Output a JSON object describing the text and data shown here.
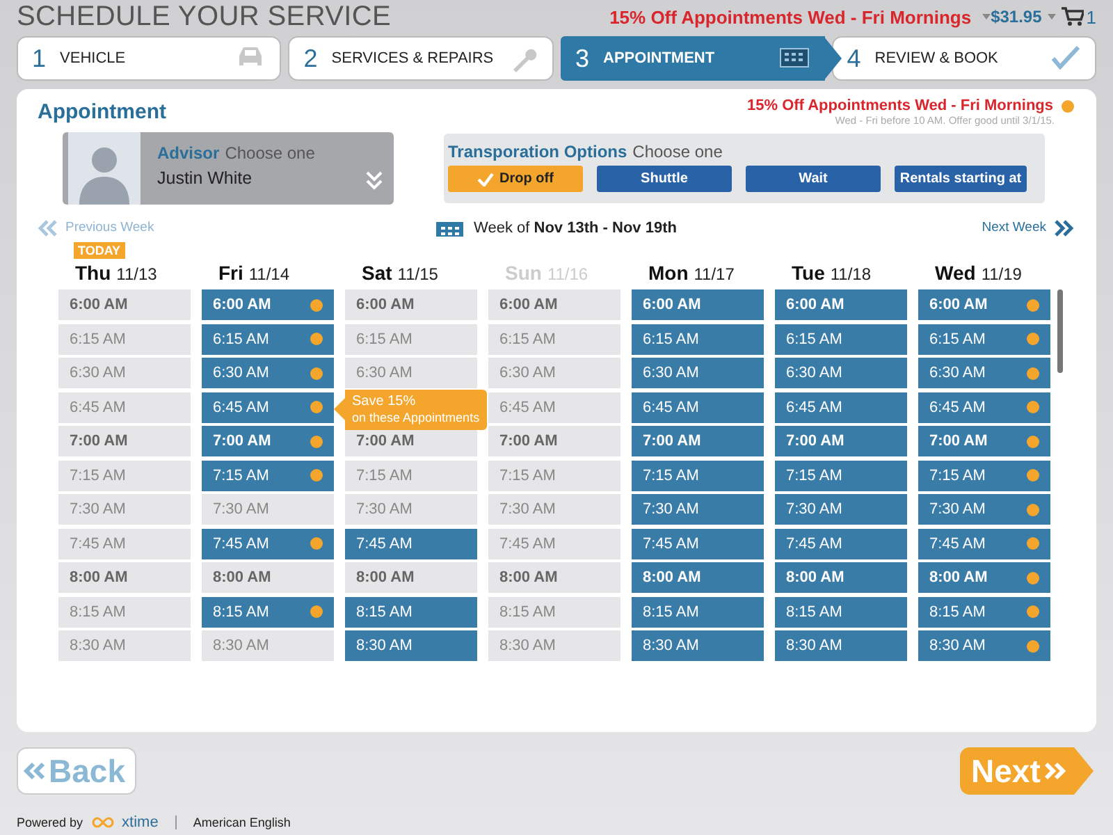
{
  "header": {
    "title": "SCHEDULE YOUR SERVICE",
    "promo": "15% Off Appointments Wed - Fri Mornings",
    "price": "$31.95",
    "cart_count": "1"
  },
  "steps": [
    {
      "number": "1",
      "label": "VEHICLE",
      "selected": false
    },
    {
      "number": "2",
      "label": "SERVICES & REPAIRS",
      "selected": false
    },
    {
      "number": "3",
      "label": "APPOINTMENT",
      "selected": true
    },
    {
      "number": "4",
      "label": "REVIEW & BOOK",
      "selected": false
    }
  ],
  "panel": {
    "title": "Appointment",
    "offer_title": "15% Off Appointments Wed - Fri Mornings",
    "offer_note": "Wed - Fri before 10 AM. Offer good until 3/1/15."
  },
  "advisor": {
    "label": "Advisor",
    "hint": "Choose one",
    "value": "Justin White"
  },
  "transportation": {
    "label": "Transporation Options",
    "hint": "Choose one",
    "options": [
      {
        "label": "Drop off",
        "selected": true
      },
      {
        "label": "Shuttle",
        "selected": false
      },
      {
        "label": "Wait",
        "selected": false
      },
      {
        "label": "Rentals starting at",
        "selected": false
      }
    ]
  },
  "week_nav": {
    "previous": "Previous Week",
    "week_prefix": "Week of",
    "week_range": "Nov 13th - Nov 19th",
    "next": "Next Week"
  },
  "days": [
    {
      "name": "Thu",
      "date": "11/13",
      "badge": "TODAY",
      "disabled": false,
      "slots": [
        {
          "time": "6:00 AM",
          "bold": true,
          "available": false,
          "discount": false
        },
        {
          "time": "6:15 AM",
          "bold": false,
          "available": false,
          "discount": false
        },
        {
          "time": "6:30 AM",
          "bold": false,
          "available": false,
          "discount": false
        },
        {
          "time": "6:45 AM",
          "bold": false,
          "available": false,
          "discount": false
        },
        {
          "time": "7:00 AM",
          "bold": true,
          "available": false,
          "discount": false
        },
        {
          "time": "7:15 AM",
          "bold": false,
          "available": false,
          "discount": false
        },
        {
          "time": "7:30 AM",
          "bold": false,
          "available": false,
          "discount": false
        },
        {
          "time": "7:45 AM",
          "bold": false,
          "available": false,
          "discount": false
        },
        {
          "time": "8:00 AM",
          "bold": true,
          "available": false,
          "discount": false
        },
        {
          "time": "8:15 AM",
          "bold": false,
          "available": false,
          "discount": false
        },
        {
          "time": "8:30 AM",
          "bold": false,
          "available": false,
          "discount": false
        }
      ]
    },
    {
      "name": "Fri",
      "date": "11/14",
      "disabled": false,
      "slots": [
        {
          "time": "6:00 AM",
          "bold": true,
          "available": true,
          "discount": true
        },
        {
          "time": "6:15 AM",
          "bold": false,
          "available": true,
          "discount": true
        },
        {
          "time": "6:30 AM",
          "bold": false,
          "available": true,
          "discount": true
        },
        {
          "time": "6:45 AM",
          "bold": false,
          "available": true,
          "discount": true
        },
        {
          "time": "7:00 AM",
          "bold": true,
          "available": true,
          "discount": true
        },
        {
          "time": "7:15 AM",
          "bold": false,
          "available": true,
          "discount": true
        },
        {
          "time": "7:30 AM",
          "bold": false,
          "available": false,
          "discount": false
        },
        {
          "time": "7:45 AM",
          "bold": false,
          "available": true,
          "discount": true
        },
        {
          "time": "8:00 AM",
          "bold": true,
          "available": false,
          "discount": false
        },
        {
          "time": "8:15 AM",
          "bold": false,
          "available": true,
          "discount": true
        },
        {
          "time": "8:30 AM",
          "bold": false,
          "available": false,
          "discount": false
        }
      ]
    },
    {
      "name": "Sat",
      "date": "11/15",
      "disabled": false,
      "slots": [
        {
          "time": "6:00 AM",
          "bold": true,
          "available": false,
          "discount": false
        },
        {
          "time": "6:15 AM",
          "bold": false,
          "available": false,
          "discount": false
        },
        {
          "time": "6:30 AM",
          "bold": false,
          "available": false,
          "discount": false
        },
        {
          "tooltip": {
            "line1": "Save 15%",
            "line2": "on these Appointments"
          }
        },
        {
          "time": "7:00 AM",
          "bold": true,
          "available": false,
          "discount": false
        },
        {
          "time": "7:15 AM",
          "bold": false,
          "available": false,
          "discount": false
        },
        {
          "time": "7:30 AM",
          "bold": false,
          "available": false,
          "discount": false
        },
        {
          "time": "7:45 AM",
          "bold": false,
          "available": true,
          "discount": false
        },
        {
          "time": "8:00 AM",
          "bold": true,
          "available": false,
          "discount": false
        },
        {
          "time": "8:15 AM",
          "bold": false,
          "available": true,
          "discount": false
        },
        {
          "time": "8:30 AM",
          "bold": false,
          "available": true,
          "discount": false
        }
      ]
    },
    {
      "name": "Sun",
      "date": "11/16",
      "disabled": true,
      "slots": [
        {
          "time": "6:00 AM",
          "bold": true,
          "available": false,
          "discount": false
        },
        {
          "time": "6:15 AM",
          "bold": false,
          "available": false,
          "discount": false
        },
        {
          "time": "6:30 AM",
          "bold": false,
          "available": false,
          "discount": false
        },
        {
          "time": "6:45 AM",
          "bold": false,
          "available": false,
          "discount": false
        },
        {
          "time": "7:00 AM",
          "bold": true,
          "available": false,
          "discount": false
        },
        {
          "time": "7:15 AM",
          "bold": false,
          "available": false,
          "discount": false
        },
        {
          "time": "7:30 AM",
          "bold": false,
          "available": false,
          "discount": false
        },
        {
          "time": "7:45 AM",
          "bold": false,
          "available": false,
          "discount": false
        },
        {
          "time": "8:00 AM",
          "bold": true,
          "available": false,
          "discount": false
        },
        {
          "time": "8:15 AM",
          "bold": false,
          "available": false,
          "discount": false
        },
        {
          "time": "8:30 AM",
          "bold": false,
          "available": false,
          "discount": false
        }
      ]
    },
    {
      "name": "Mon",
      "date": "11/17",
      "disabled": false,
      "slots": [
        {
          "time": "6:00 AM",
          "bold": true,
          "available": true,
          "discount": false
        },
        {
          "time": "6:15 AM",
          "bold": false,
          "available": true,
          "discount": false
        },
        {
          "time": "6:30 AM",
          "bold": false,
          "available": true,
          "discount": false
        },
        {
          "time": "6:45 AM",
          "bold": false,
          "available": true,
          "discount": false
        },
        {
          "time": "7:00 AM",
          "bold": true,
          "available": true,
          "discount": false
        },
        {
          "time": "7:15 AM",
          "bold": false,
          "available": true,
          "discount": false
        },
        {
          "time": "7:30 AM",
          "bold": false,
          "available": true,
          "discount": false
        },
        {
          "time": "7:45 AM",
          "bold": false,
          "available": true,
          "discount": false
        },
        {
          "time": "8:00 AM",
          "bold": true,
          "available": true,
          "discount": false
        },
        {
          "time": "8:15 AM",
          "bold": false,
          "available": true,
          "discount": false
        },
        {
          "time": "8:30 AM",
          "bold": false,
          "available": true,
          "discount": false
        }
      ]
    },
    {
      "name": "Tue",
      "date": "11/18",
      "disabled": false,
      "slots": [
        {
          "time": "6:00 AM",
          "bold": true,
          "available": true,
          "discount": false
        },
        {
          "time": "6:15 AM",
          "bold": false,
          "available": true,
          "discount": false
        },
        {
          "time": "6:30 AM",
          "bold": false,
          "available": true,
          "discount": false
        },
        {
          "time": "6:45 AM",
          "bold": false,
          "available": true,
          "discount": false
        },
        {
          "time": "7:00 AM",
          "bold": true,
          "available": true,
          "discount": false
        },
        {
          "time": "7:15 AM",
          "bold": false,
          "available": true,
          "discount": false
        },
        {
          "time": "7:30 AM",
          "bold": false,
          "available": true,
          "discount": false
        },
        {
          "time": "7:45 AM",
          "bold": false,
          "available": true,
          "discount": false
        },
        {
          "time": "8:00 AM",
          "bold": true,
          "available": true,
          "discount": false
        },
        {
          "time": "8:15 AM",
          "bold": false,
          "available": true,
          "discount": false
        },
        {
          "time": "8:30 AM",
          "bold": false,
          "available": true,
          "discount": false
        }
      ]
    },
    {
      "name": "Wed",
      "date": "11/19",
      "disabled": false,
      "slots": [
        {
          "time": "6:00 AM",
          "bold": true,
          "available": true,
          "discount": true
        },
        {
          "time": "6:15 AM",
          "bold": false,
          "available": true,
          "discount": true
        },
        {
          "time": "6:30 AM",
          "bold": false,
          "available": true,
          "discount": true
        },
        {
          "time": "6:45 AM",
          "bold": false,
          "available": true,
          "discount": true
        },
        {
          "time": "7:00 AM",
          "bold": true,
          "available": true,
          "discount": true
        },
        {
          "time": "7:15 AM",
          "bold": false,
          "available": true,
          "discount": true
        },
        {
          "time": "7:30 AM",
          "bold": false,
          "available": true,
          "discount": true
        },
        {
          "time": "7:45 AM",
          "bold": false,
          "available": true,
          "discount": true
        },
        {
          "time": "8:00 AM",
          "bold": true,
          "available": true,
          "discount": true
        },
        {
          "time": "8:15 AM",
          "bold": false,
          "available": true,
          "discount": true
        },
        {
          "time": "8:30 AM",
          "bold": false,
          "available": true,
          "discount": true
        }
      ]
    }
  ],
  "buttons": {
    "back": "Back",
    "next": "Next"
  },
  "footer": {
    "powered_by": "Powered by",
    "brand": "xtime",
    "language": "American English"
  }
}
